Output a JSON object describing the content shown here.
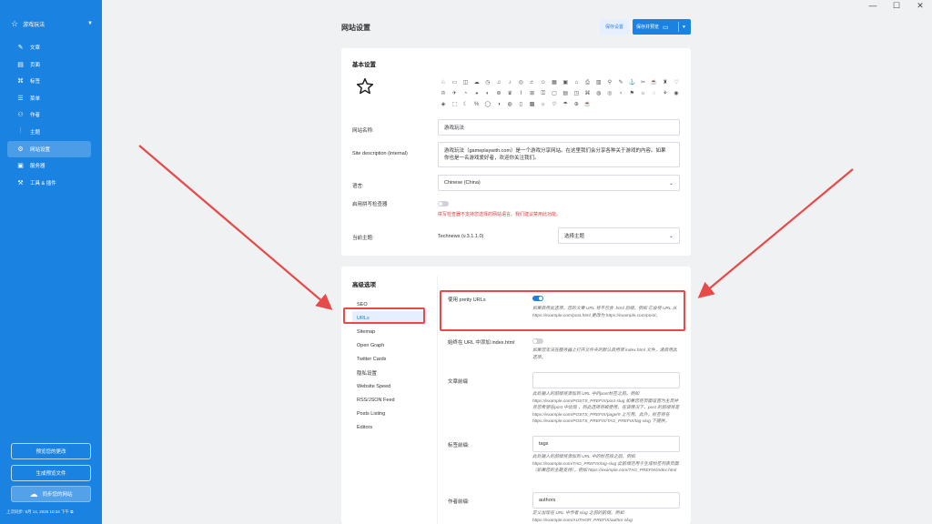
{
  "window": {
    "minimize": "—",
    "maximize": "☐",
    "close": "✕"
  },
  "sidebar": {
    "site_name": "游戏玩法",
    "items": [
      {
        "icon": "✎",
        "label": "文章"
      },
      {
        "icon": "▤",
        "label": "页面"
      },
      {
        "icon": "⌘",
        "label": "标签"
      },
      {
        "icon": "☰",
        "label": "菜单"
      },
      {
        "icon": "⚇",
        "label": "作者"
      },
      {
        "icon": "⫶",
        "label": "主题"
      },
      {
        "icon": "⚙",
        "label": "网站设置"
      },
      {
        "icon": "▣",
        "label": "服务器"
      },
      {
        "icon": "⚒",
        "label": "工具 & 插件"
      }
    ],
    "btn_preview_changes": "预览您的更改",
    "btn_generate_preview": "生成预览文件",
    "btn_sync": "同步您的网站",
    "footer": "上次同步: 9月 14, 2025 10:34 下午"
  },
  "header": {
    "title": "网站设置",
    "save_label": "保存设置",
    "preview_label": "保存并预览"
  },
  "basic": {
    "title": "基本设置",
    "icons": [
      "♘",
      "▭",
      "◫",
      "☁",
      "◷",
      "♫",
      "♪",
      "◎",
      "♬",
      "☺",
      "▦",
      "▣",
      "⌂",
      "⎙",
      "▥",
      "⚲",
      "✎",
      "⚓",
      "✂",
      "☕",
      "♜",
      "♡",
      "♔",
      "✈",
      "◔",
      "◕",
      "◐",
      "⊛",
      "♛",
      "⌇",
      "⊞",
      "⚿",
      "▢",
      "▤",
      "◳",
      "⌘",
      "◍",
      "◎",
      "♀",
      "⚑",
      "☼",
      "◌",
      "⚘",
      "◉",
      "◈",
      "⬚",
      "☾",
      "%",
      "◯",
      "◑",
      "◍",
      "▯",
      "▩",
      "☼",
      "⛆",
      "☂",
      "⊕",
      "☕"
    ],
    "site_name_label": "网站名称:",
    "site_name_value": "游戏玩法",
    "desc_label": "Site description (internal)",
    "desc_value": "游戏玩法（gameplaywith.com）是一个游戏分享网站。在这里我们会分享各种关于游戏的内容。如果\n你也是一名游戏爱好者，欢迎你关注我们。",
    "lang_label": "语言:",
    "lang_value": "Chinese (China)",
    "spell_label": "启用拼写检查器",
    "spell_hint": "拼写检查器不支持您选择的网站语言。我们建议禁用此功能。",
    "theme_label": "当前主题:",
    "theme_value": "Technews (v.3.1.1.0)",
    "theme_select": "选择主题"
  },
  "advanced": {
    "title": "高级选项",
    "tabs": [
      "SEO",
      "URLs",
      "Sitemap",
      "Open Graph",
      "Twitter Cards",
      "隐私设置",
      "Website Speed",
      "RSS/JSON Feed",
      "Posts Listing",
      "Editors"
    ],
    "active_tab": "URLs",
    "pretty_label": "使用 pretty URLs",
    "pretty_desc": "如果启用此选项，您的文章 URL 将不包含 .html 后缀。例如 它会将 URL 从 https://example.com/post.html 更改为 https://example.com/post/。",
    "index_label": "始终在 URL 中添加 index.html",
    "index_desc": "如果您无法在服务器上打开文件夹的默认启用项 index.html 文件，请启用此选项。",
    "post_prefix_label": "文章前缀",
    "post_prefix_value": "",
    "post_prefix_desc": "此处输入的前缀将添加到 URL 中的post标签之前。例如 https://example.com/POSTS_PREFIX/post-slug 如果您将页面设置为主页并且您希望在post 中出现 ，则此选项将被使用。在该情况下，post 的前缀将是 https://example.com/POSTS_PREFIX/page/9 上可用。此外，标签将在 https://example.com/POSTS_PREFIX/TAG_PREFIX/tag-slug 下提供。",
    "tag_prefix_label": "标签前缀:",
    "tag_prefix_value": "tags",
    "tag_prefix_desc": "此处输入的前缀将添加到 URL 中的标签段之前。例如 https://example.com/TAG_PREFIX/tag-slug 此前缀还用于生成标签列表页面（如果您的主题支持）。例如 https://example.com/TAG_PREFIX/index.html",
    "author_prefix_label": "作者前缀:",
    "author_prefix_value": "authors",
    "author_prefix_desc": "定义出现在 URL 中作者 slug 之前的前缀。例如 https://example.com/AUTHOR_PREFIX/author-slug"
  },
  "colors": {
    "accent": "#1a82e0",
    "annotation": "#e84a4a"
  }
}
